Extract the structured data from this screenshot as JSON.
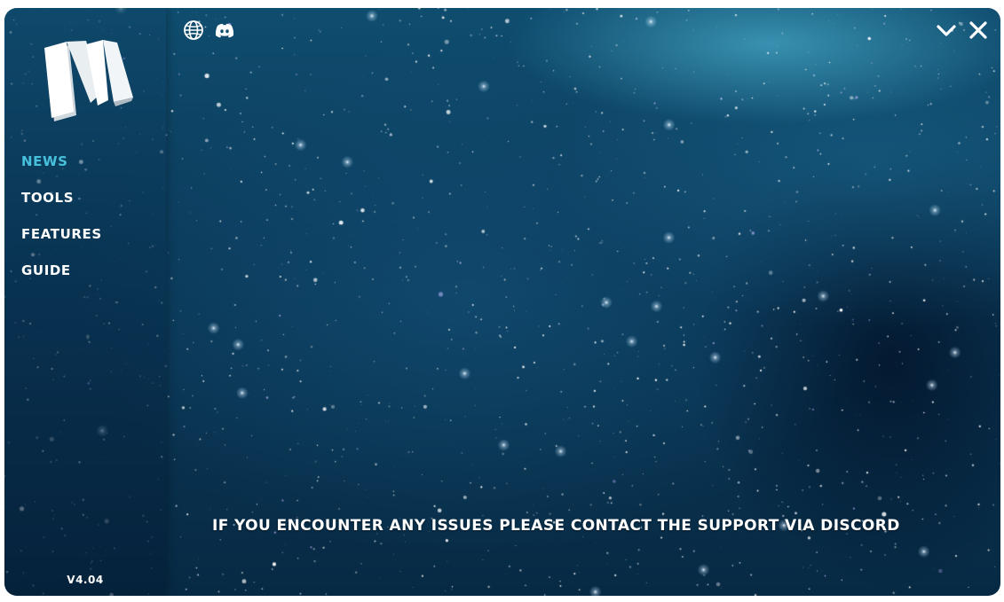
{
  "app": {
    "logo_name": "N",
    "version": "V4.04"
  },
  "sidebar": {
    "items": [
      {
        "label": "NEWS",
        "active": true
      },
      {
        "label": "TOOLS",
        "active": false
      },
      {
        "label": "FEATURES",
        "active": false
      },
      {
        "label": "GUIDE",
        "active": false
      }
    ]
  },
  "topbar": {
    "left_icons": [
      "globe-icon",
      "discord-icon"
    ],
    "right_icons": [
      "chevron-down-icon",
      "close-icon"
    ]
  },
  "main": {
    "support_message": "IF YOU ENCOUNTER ANY ISSUES PLEASE CONTACT THE SUPPORT VIA DISCORD"
  },
  "colors": {
    "accent": "#47c0dc",
    "text": "#ffffff",
    "background_dark": "#072a44",
    "background_mid": "#0f4d6f"
  }
}
